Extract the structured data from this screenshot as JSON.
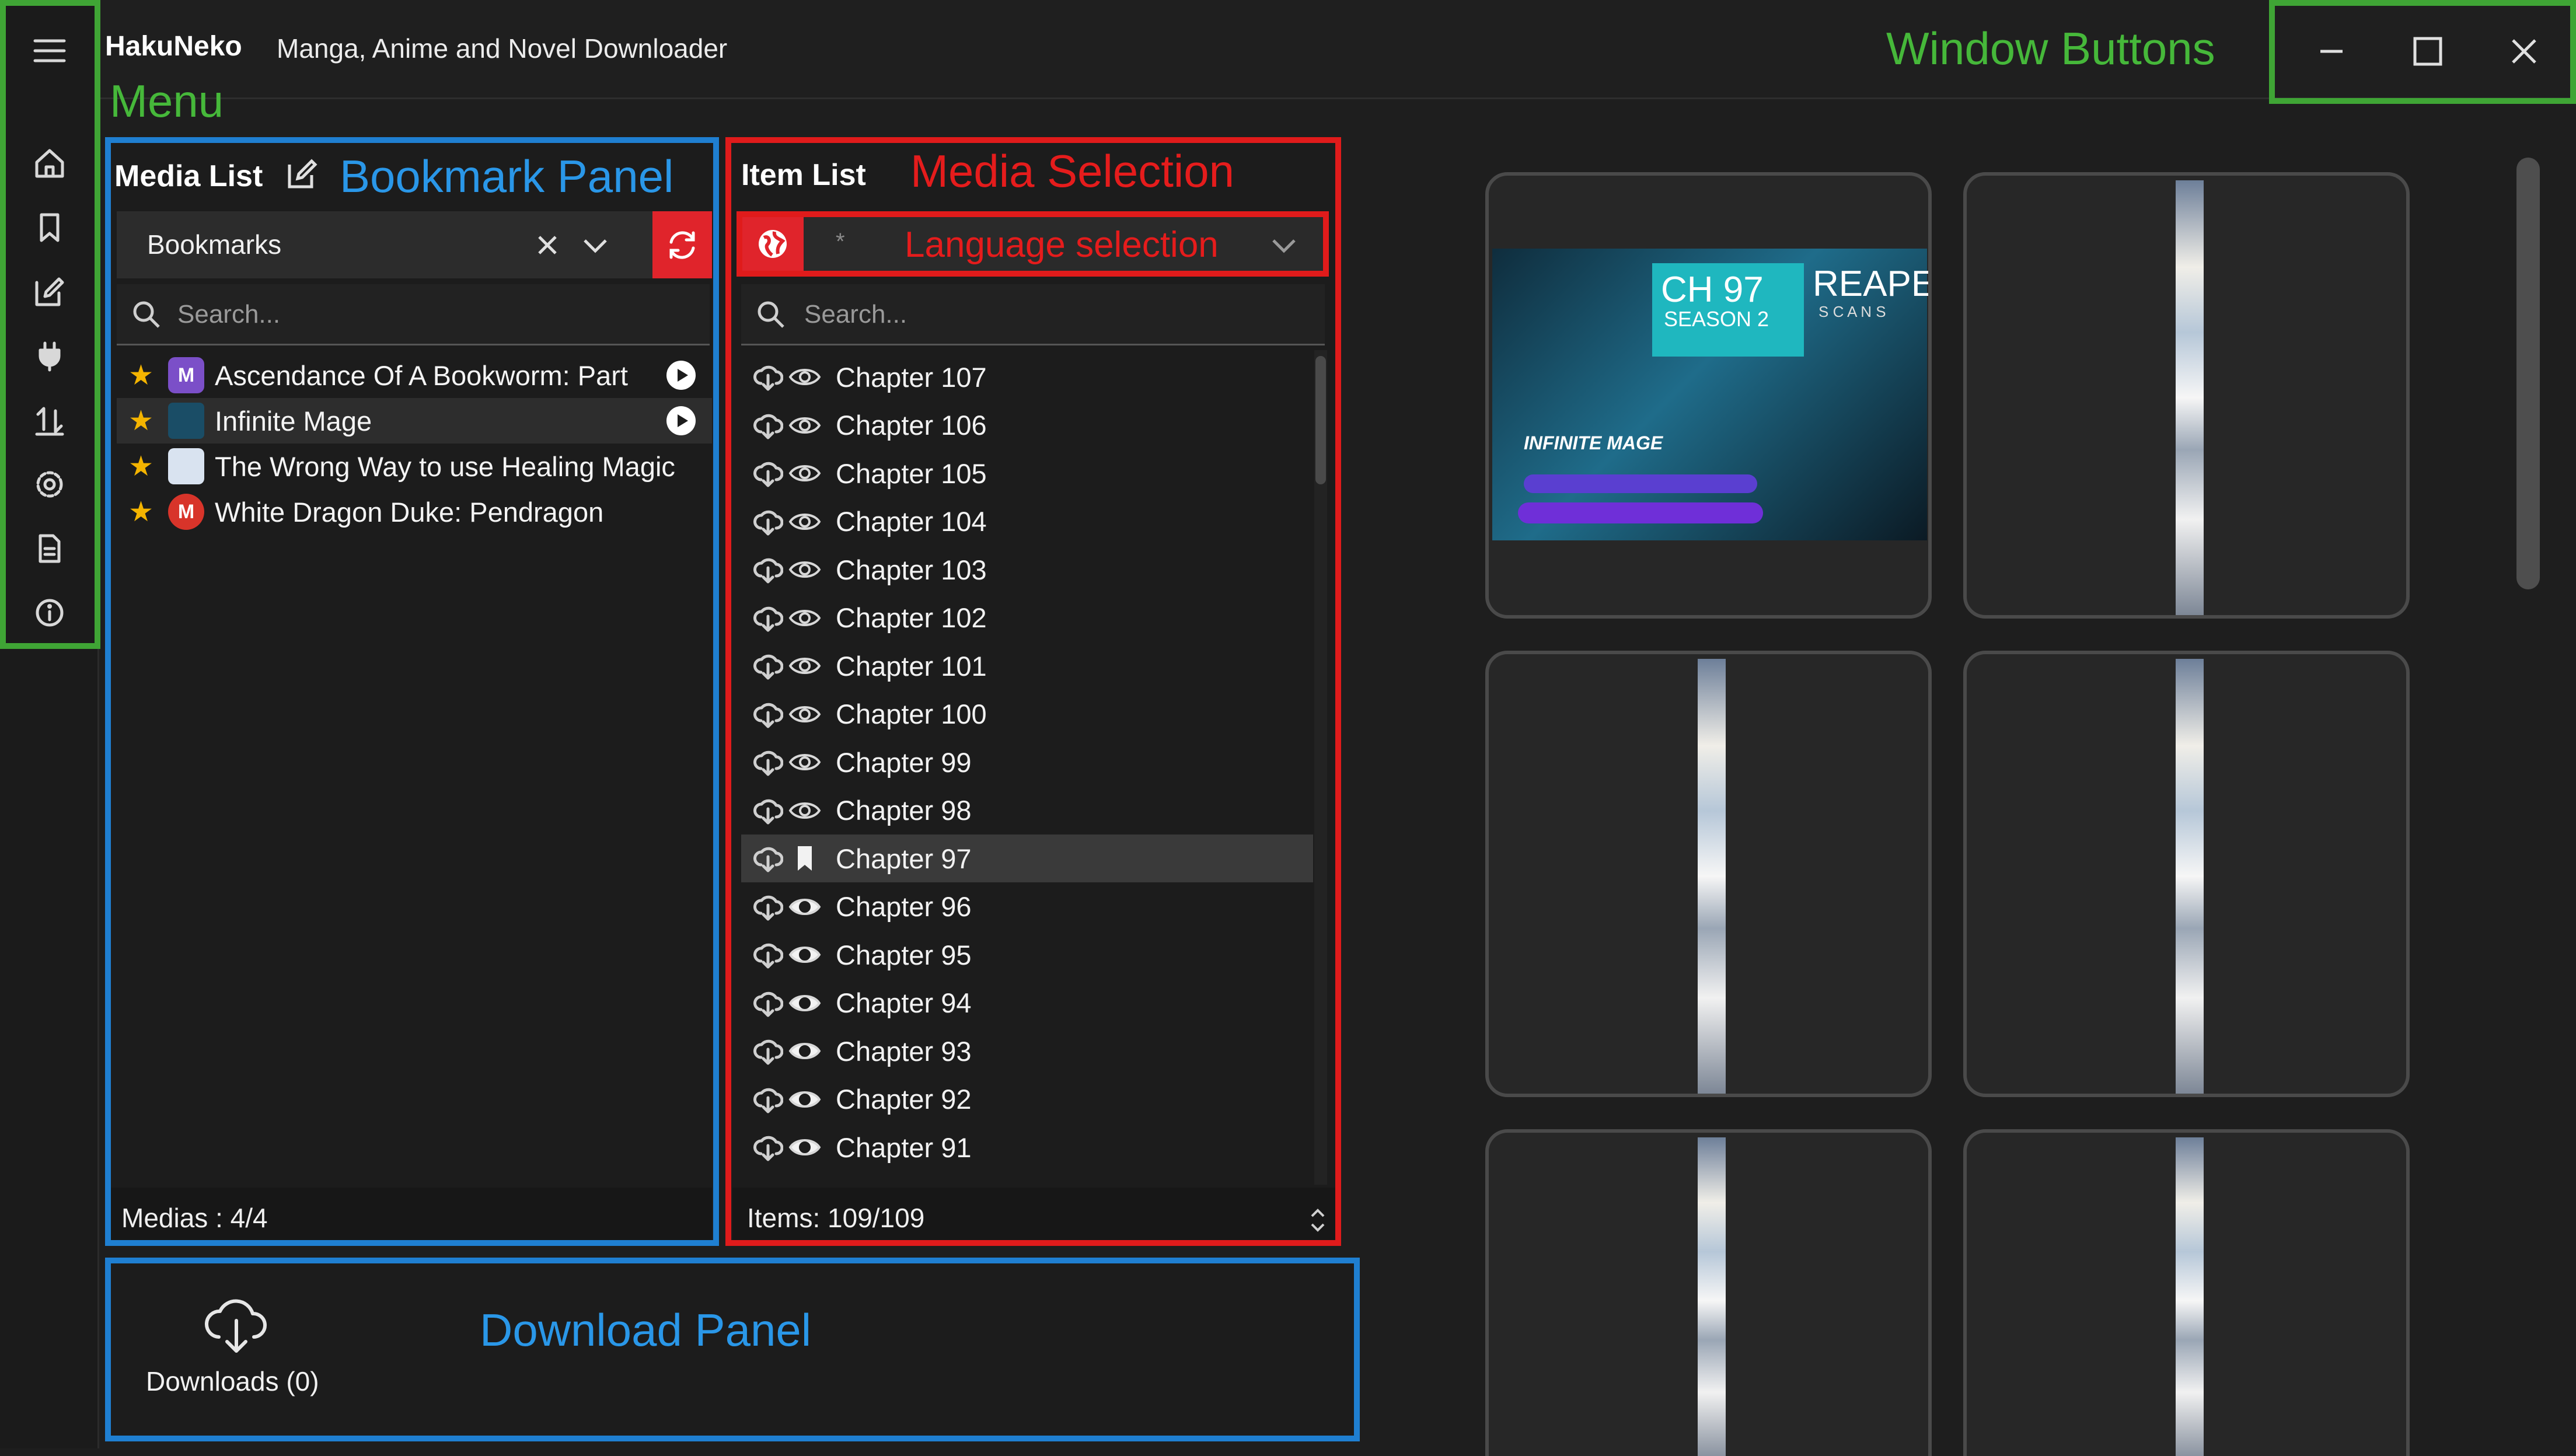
{
  "app": {
    "name": "HakuNeko",
    "subtitle": "Manga, Anime and Novel Downloader"
  },
  "window_buttons": [
    "minimize",
    "maximize",
    "close"
  ],
  "rail_icons": [
    "home-icon",
    "bookmark-icon",
    "edit-icon",
    "plugin-icon",
    "transfer-icon",
    "settings-icon",
    "document-icon",
    "info-icon"
  ],
  "media_list": {
    "header": "Media List",
    "selected_list": "Bookmarks",
    "search_placeholder": "Search...",
    "items": [
      {
        "title": "Ascendance Of A Bookworm: Part",
        "icon_letter": "M",
        "icon_color": "#7b4fc8",
        "play": true
      },
      {
        "title": "Infinite Mage",
        "icon_letter": "",
        "icon_color": "#1a4d66",
        "play": true
      },
      {
        "title": "The Wrong Way to use Healing Magic",
        "icon_letter": "",
        "icon_color": "#d9e3f0",
        "play": false
      },
      {
        "title": "White Dragon Duke: Pendragon",
        "icon_letter": "M",
        "icon_color": "#d8342a",
        "play": false
      }
    ],
    "footer": "Medias : 4/4"
  },
  "item_list": {
    "header": "Item List",
    "lang_value": "*",
    "search_placeholder": "Search...",
    "chapters": [
      {
        "label": "Chapter 107",
        "eye": "outline"
      },
      {
        "label": "Chapter 106",
        "eye": "outline"
      },
      {
        "label": "Chapter 105",
        "eye": "outline"
      },
      {
        "label": "Chapter 104",
        "eye": "outline"
      },
      {
        "label": "Chapter 103",
        "eye": "outline"
      },
      {
        "label": "Chapter 102",
        "eye": "outline"
      },
      {
        "label": "Chapter 101",
        "eye": "outline"
      },
      {
        "label": "Chapter 100",
        "eye": "outline"
      },
      {
        "label": "Chapter 99",
        "eye": "outline"
      },
      {
        "label": "Chapter 98",
        "eye": "outline"
      },
      {
        "label": "Chapter 97",
        "eye": "bookmark",
        "selected": true
      },
      {
        "label": "Chapter 96",
        "eye": "filled"
      },
      {
        "label": "Chapter 95",
        "eye": "filled"
      },
      {
        "label": "Chapter 94",
        "eye": "filled"
      },
      {
        "label": "Chapter 93",
        "eye": "filled"
      },
      {
        "label": "Chapter 92",
        "eye": "filled"
      },
      {
        "label": "Chapter 91",
        "eye": "filled"
      }
    ],
    "footer": "Items: 109/109"
  },
  "downloads": {
    "label": "Downloads (0)"
  },
  "annotations": {
    "menu": "Menu",
    "window_buttons": "Window Buttons",
    "bookmark_panel": "Bookmark Panel",
    "media_selection": "Media Selection",
    "language_selection": "Language selection",
    "download_panel": "Download Panel"
  },
  "preview_cover": {
    "chapter": "CH 97",
    "season": "SEASON 2",
    "brand": "REAPER",
    "brand_sub": "S C A N S",
    "series": "INFINITE MAGE"
  },
  "colors": {
    "accent_red": "#e0242b",
    "annotation_green": "#3fa535",
    "annotation_blue": "#1f7fd1",
    "annotation_red": "#e01b1b",
    "star": "#f4b400"
  }
}
